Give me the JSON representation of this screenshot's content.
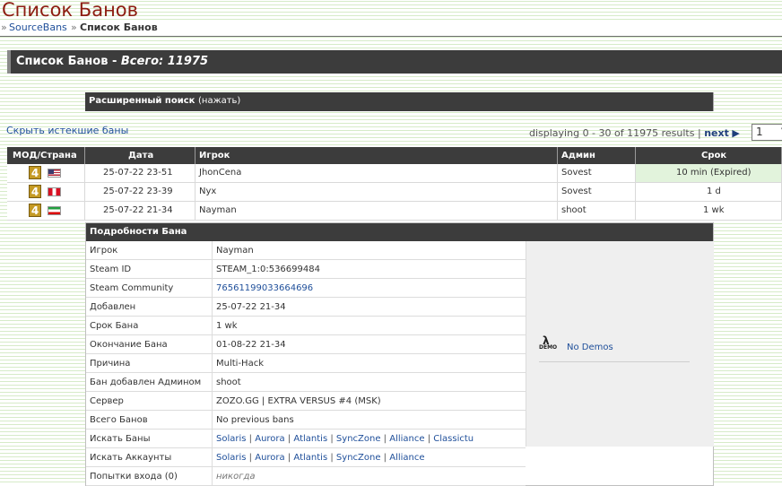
{
  "page_title": "Список Банов",
  "breadcrumb": {
    "sep": "»",
    "home": "SourceBans",
    "current": "Список Банов"
  },
  "header": {
    "prefix": "Список Банов - ",
    "total": "Всего: 11975"
  },
  "advanced_search": {
    "label": "Расширенный поиск",
    "toggle": "(нажать)"
  },
  "hide_expired": "Скрыть истекшие баны",
  "pager": {
    "text": "displaying 0 - 30 of 11975 results",
    "sep": "|",
    "next": "next",
    "arrow": "▶",
    "page": "1"
  },
  "columns": [
    "МОД/Страна",
    "Дата",
    "Игрок",
    "Админ",
    "Срок"
  ],
  "bans": [
    {
      "game_icon": "4",
      "flag": "us-flag-icon",
      "date": "25-07-22 23-51",
      "player": "JhonCena",
      "admin": "Sovest",
      "length": "10 min (Expired)",
      "expired": true
    },
    {
      "game_icon": "4",
      "flag": "peru-flag-icon",
      "date": "25-07-22 23-39",
      "player": "Nyx",
      "admin": "Sovest",
      "length": "1 d",
      "expired": false
    },
    {
      "game_icon": "4",
      "flag": "iran-flag-icon",
      "date": "25-07-22 21-34",
      "player": "Nayman",
      "admin": "shoot",
      "length": "1 wk",
      "expired": false
    }
  ],
  "details": {
    "title": "Подробности Бана",
    "rows": [
      {
        "key": "Игрок",
        "value": "Nayman"
      },
      {
        "key": "Steam ID",
        "value": "STEAM_1:0:536699484"
      },
      {
        "key": "Steam Community",
        "value": "76561199033664696"
      },
      {
        "key": "Добавлен",
        "value": "25-07-22 21-34"
      },
      {
        "key": "Срок Бана",
        "value": "1 wk"
      },
      {
        "key": "Окончание Бана",
        "value": "01-08-22 21-34"
      },
      {
        "key": "Причина",
        "value": "Multi-Hack"
      },
      {
        "key": "Бан добавлен Админом",
        "value": "shoot"
      },
      {
        "key": "Сервер",
        "value": "ZOZO.GG | EXTRA VERSUS #4 (MSK)"
      },
      {
        "key": "Всего Банов",
        "value": "No previous bans"
      }
    ],
    "search_bans": {
      "key": "Искать Баны",
      "links": [
        "Solaris",
        "Aurora",
        "Atlantis",
        "SyncZone",
        "Alliance",
        "Classictu"
      ]
    },
    "search_accounts": {
      "key": "Искать Аккаунты",
      "links": [
        "Solaris",
        "Aurora",
        "Atlantis",
        "SyncZone",
        "Alliance"
      ]
    },
    "login_attempts": {
      "key": "Попытки входа (0)",
      "value": "никогда"
    },
    "demos": {
      "icon_top": "λ",
      "icon_bottom": "DEMO",
      "label": "No Demos"
    }
  },
  "colors": {
    "header_bg": "#3c3c3c",
    "title_red": "#8c1d11",
    "link_blue": "#1f4f9a",
    "expired_bg": "#e2f3dc"
  }
}
